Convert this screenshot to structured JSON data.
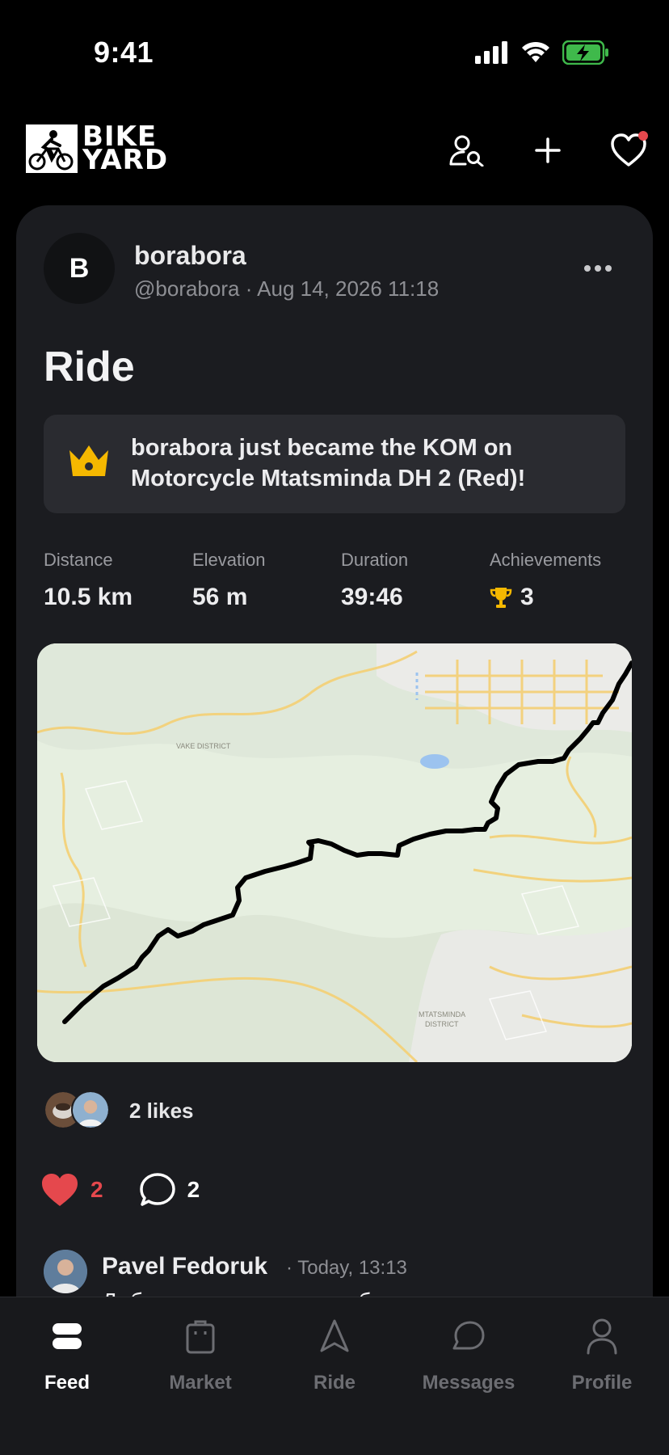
{
  "status_bar": {
    "time": "9:41"
  },
  "header": {
    "logo_line1": "BIKE",
    "logo_line2": "YARD"
  },
  "post": {
    "avatar_initial": "B",
    "author_name": "borabora",
    "author_meta": "@borabora · Aug 14, 2026 11:18",
    "title": "Ride",
    "kom_text": "borabora just became the KOM on Motorcycle Mtatsminda DH 2 (Red)!",
    "stats": {
      "distance_label": "Distance",
      "distance_value": "10.5 km",
      "elevation_label": "Elevation",
      "elevation_value": "56 m",
      "duration_label": "Duration",
      "duration_value": "39:46",
      "achievements_label": "Achievements",
      "achievements_value": "3"
    },
    "map": {
      "label_vake": "VAKE DISTRICT",
      "label_mtatsminda_1": "MTATSMINDA",
      "label_mtatsminda_2": "DISTRICT"
    },
    "likes_text": "2 likes",
    "like_count": "2",
    "comment_count": "2",
    "comment": {
      "name": "Pavel Fedoruk",
      "time": "· Today, 13:13",
      "text": "Добро пожаловать в клуб"
    }
  },
  "tabs": {
    "feed": "Feed",
    "market": "Market",
    "ride": "Ride",
    "messages": "Messages",
    "profile": "Profile"
  },
  "colors": {
    "accent_red": "#e5484d",
    "kom_gold": "#f5b800",
    "card_bg": "#1b1c20"
  }
}
